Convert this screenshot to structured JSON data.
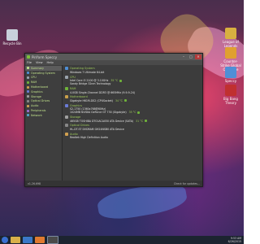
{
  "window": {
    "title": "Piriform Speccy",
    "menus": [
      "File",
      "View",
      "Help"
    ],
    "minimize": "–",
    "maximize": "□",
    "close": "✕"
  },
  "nav": [
    {
      "label": "Summary",
      "color": "#bfe08a"
    },
    {
      "label": "Operating System",
      "color": "#4f8fd6"
    },
    {
      "label": "CPU",
      "color": "#9aa3ad"
    },
    {
      "label": "RAM",
      "color": "#6fb23a"
    },
    {
      "label": "Motherboard",
      "color": "#caa04a"
    },
    {
      "label": "Graphics",
      "color": "#6a7bd6"
    },
    {
      "label": "Storage",
      "color": "#a0a0a0"
    },
    {
      "label": "Optical Drives",
      "color": "#888888"
    },
    {
      "label": "Audio",
      "color": "#d0a050"
    },
    {
      "label": "Peripherals",
      "color": "#9a6fd0"
    },
    {
      "label": "Network",
      "color": "#4fa6c8"
    }
  ],
  "sections": [
    {
      "name": "Operating System",
      "color": "#4f8fd6",
      "lines": [
        {
          "text": "Windows 7 Ultimate 64-bit"
        }
      ]
    },
    {
      "name": "CPU",
      "color": "#9aa3ad",
      "lines": [
        {
          "text": "Intel Core i3 2100 @ 3.10GHz",
          "temp": "35 °C"
        },
        {
          "text": "Sandy Bridge 32nm Technology"
        }
      ]
    },
    {
      "name": "RAM",
      "color": "#6fb23a",
      "lines": [
        {
          "text": "4.0GB Single-Channel DDR3 @ 665MHz (9-9-9-24)"
        }
      ]
    },
    {
      "name": "Motherboard",
      "color": "#caa04a",
      "lines": [
        {
          "text": "Gigabyte H61M-DS2 (CPUSocket)",
          "temp": "34 °C"
        }
      ]
    },
    {
      "name": "Graphics",
      "color": "#6a7bd6",
      "lines": [
        {
          "text": "S2-1750 (1360x768@60Hz)"
        },
        {
          "text": "1024MB NVIDIA GeForce GT 730 (Gigabyte)",
          "temp": "35 °C"
        }
      ]
    },
    {
      "name": "Storage",
      "color": "#a0a0a0",
      "lines": [
        {
          "text": "465GB TOSHIBA DT01ACA050 ATA Device (SATA)",
          "temp": "31 °C"
        }
      ]
    },
    {
      "name": "Optical Drives",
      "color": "#888888",
      "lines": [
        {
          "text": "HL-DT-ST DVDRAM GH24NSB0 ATA Device"
        }
      ]
    },
    {
      "name": "Audio",
      "color": "#d0a050",
      "lines": [
        {
          "text": "Realtek High Definition Audio"
        }
      ]
    }
  ],
  "status": {
    "version": "v1.26.698",
    "update": "Check for updates..."
  },
  "desktop_icons": [
    {
      "label": "Recycle Bin",
      "color": "#c8d0da"
    },
    {
      "label": "League of Legends",
      "color": "#d8b040"
    },
    {
      "label": "Counter-Strike Global Offensive",
      "color": "#e0a030"
    },
    {
      "label": "Speccy",
      "color": "#4f8fd6"
    },
    {
      "label": "Big Bang Theory",
      "color": "#c03030"
    }
  ],
  "taskbar": {
    "time": "9:53 AM",
    "date": "6/26/2015"
  }
}
